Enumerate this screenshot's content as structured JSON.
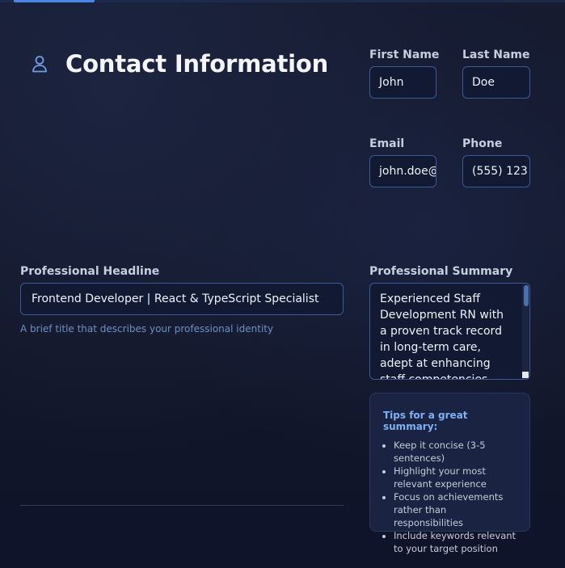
{
  "section": {
    "title": "Contact Information",
    "icon": "user-icon"
  },
  "contact": {
    "first_name": {
      "label": "First Name",
      "value": "John"
    },
    "last_name": {
      "label": "Last Name",
      "value": "Doe"
    },
    "email": {
      "label": "Email",
      "value": "john.doe@"
    },
    "phone": {
      "label": "Phone",
      "value": "(555) 123"
    }
  },
  "headline": {
    "label": "Professional Headline",
    "value": "Frontend Developer | React & TypeScript Specialist",
    "helper": "A brief title that describes your professional identity"
  },
  "summary": {
    "label": "Professional Summary",
    "value": "Experienced Staff Development RN with a proven track record in long-term care, adept at enhancing staff competencies through"
  },
  "tips": {
    "title": "Tips for a great summary:",
    "items": [
      "Keep it concise (3-5 sentences)",
      "Highlight your most relevant experience",
      "Focus on achievements rather than responsibilities",
      "Include keywords relevant to your target position"
    ]
  },
  "colors": {
    "accent": "#4a86e8",
    "input_border": "#3d5a94",
    "tips_title": "#7eb0f5"
  }
}
